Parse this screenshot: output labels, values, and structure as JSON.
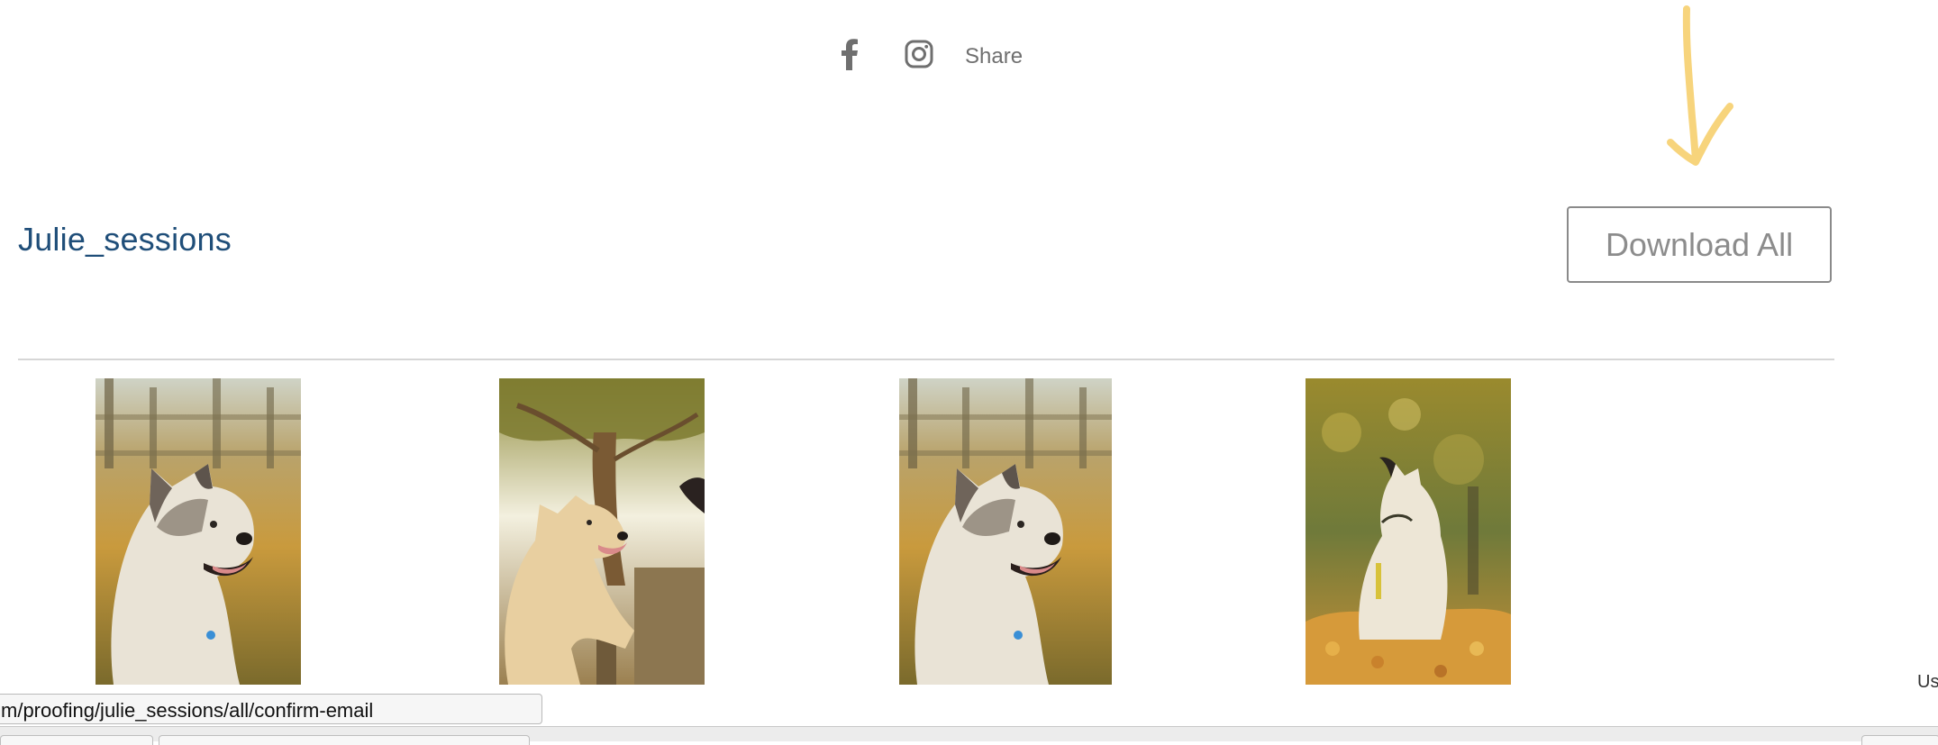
{
  "social": {
    "facebook_icon": "facebook-icon",
    "instagram_icon": "instagram-icon",
    "share_label": "Share"
  },
  "gallery": {
    "title": "Julie_sessions",
    "download_all_label": "Download All",
    "photos": [
      {
        "alt": "husky-puppy-profile"
      },
      {
        "alt": "puppy-standing-on-fence"
      },
      {
        "alt": "husky-puppy-profile"
      },
      {
        "alt": "puppy-in-autumn-leaves"
      }
    ]
  },
  "status_bar": {
    "url": "m/proofing/julie_sessions/all/confirm-email",
    "corner_text": "Us"
  },
  "colors": {
    "title_link": "#1f4e79",
    "arrow_annotation": "#f7d47c",
    "button_border": "#8a8a8a"
  }
}
